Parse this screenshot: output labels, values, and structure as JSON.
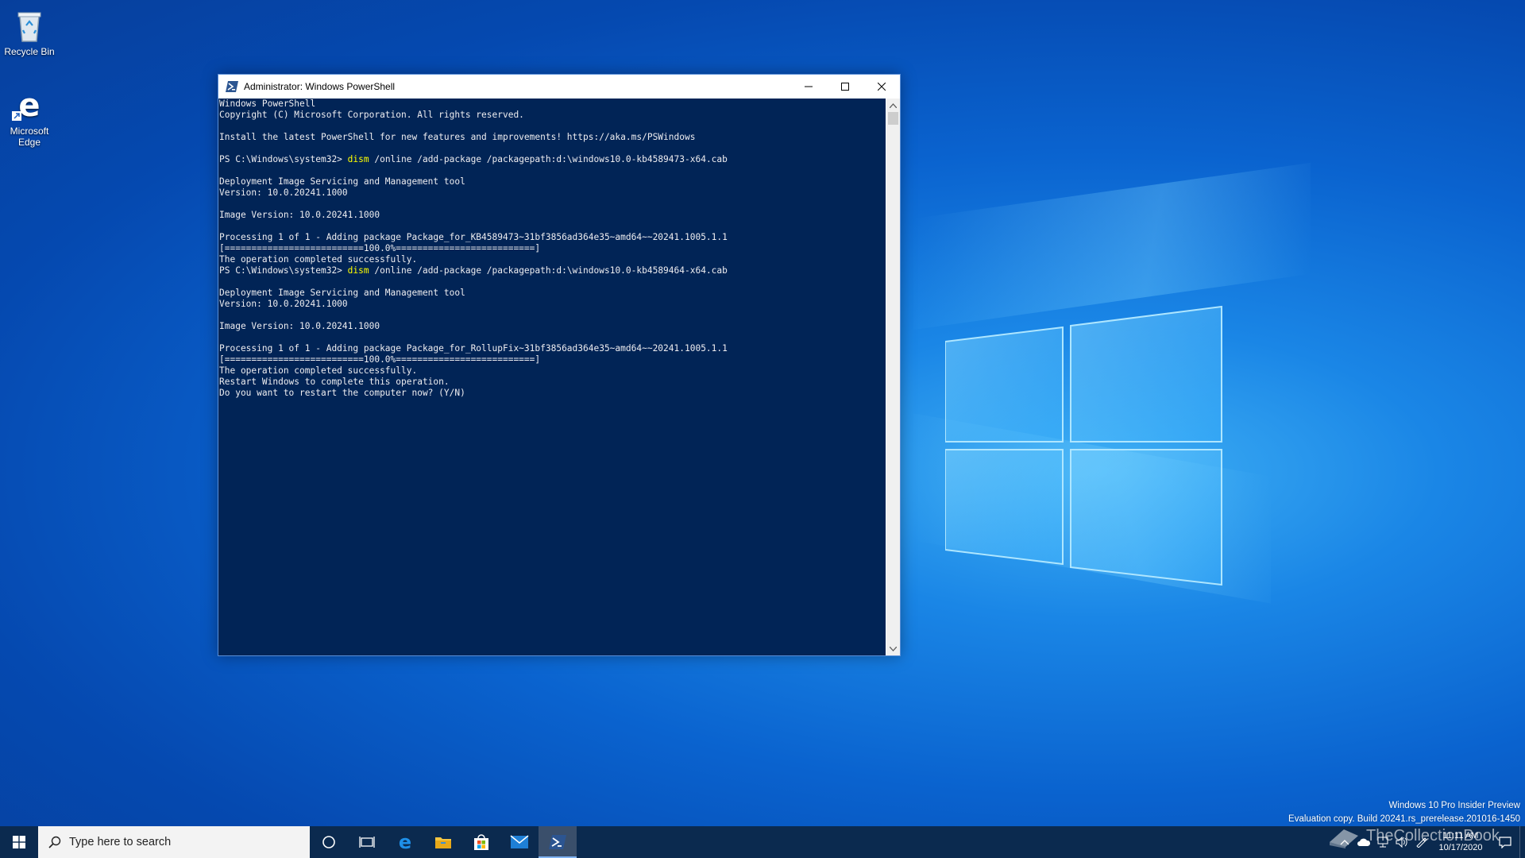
{
  "desktop": {
    "icons": [
      {
        "label": "Recycle Bin"
      },
      {
        "label_line1": "Microsoft",
        "label_line2": "Edge"
      }
    ]
  },
  "window": {
    "title": "Administrator: Windows PowerShell",
    "console_lines": [
      {
        "text": "Windows PowerShell"
      },
      {
        "text": "Copyright (C) Microsoft Corporation. All rights reserved."
      },
      {
        "text": ""
      },
      {
        "text": "Install the latest PowerShell for new features and improvements! https://aka.ms/PSWindows"
      },
      {
        "text": ""
      },
      {
        "prompt": "PS C:\\Windows\\system32> ",
        "cmd": "dism",
        "args": " /online /add-package /packagepath:d:\\windows10.0-kb4589473-x64.cab"
      },
      {
        "text": ""
      },
      {
        "text": "Deployment Image Servicing and Management tool"
      },
      {
        "text": "Version: 10.0.20241.1000"
      },
      {
        "text": ""
      },
      {
        "text": "Image Version: 10.0.20241.1000"
      },
      {
        "text": ""
      },
      {
        "text": "Processing 1 of 1 - Adding package Package_for_KB4589473~31bf3856ad364e35~amd64~~20241.1005.1.1"
      },
      {
        "text": "[==========================100.0%==========================]"
      },
      {
        "text": "The operation completed successfully."
      },
      {
        "prompt": "PS C:\\Windows\\system32> ",
        "cmd": "dism",
        "args": " /online /add-package /packagepath:d:\\windows10.0-kb4589464-x64.cab"
      },
      {
        "text": ""
      },
      {
        "text": "Deployment Image Servicing and Management tool"
      },
      {
        "text": "Version: 10.0.20241.1000"
      },
      {
        "text": ""
      },
      {
        "text": "Image Version: 10.0.20241.1000"
      },
      {
        "text": ""
      },
      {
        "text": "Processing 1 of 1 - Adding package Package_for_RollupFix~31bf3856ad364e35~amd64~~20241.1005.1.1"
      },
      {
        "text": "[==========================100.0%==========================]"
      },
      {
        "text": "The operation completed successfully."
      },
      {
        "text": "Restart Windows to complete this operation."
      },
      {
        "text": "Do you want to restart the computer now? (Y/N)"
      }
    ],
    "colors": {
      "console_bg": "#012456",
      "console_fg": "#eeedf0",
      "command": "#ffff00"
    }
  },
  "taskbar": {
    "search_placeholder": "Type here to search",
    "pinned": [
      "cortana-icon",
      "task-view-icon",
      "edge-icon",
      "file-explorer-icon",
      "store-icon",
      "mail-icon",
      "powershell-icon"
    ],
    "clock_time": "11:11 AM",
    "clock_date": "10/17/2020"
  },
  "watermark": {
    "line1": "Windows 10 Pro Insider Preview",
    "line2": "Evaluation copy. Build 20241.rs_prerelease.201016-1450"
  },
  "overlay_brand": "TheCollectionBook"
}
